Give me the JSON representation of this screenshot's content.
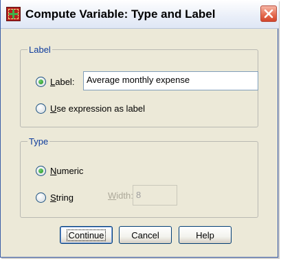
{
  "window": {
    "title": "Compute Variable: Type and Label"
  },
  "label_group": {
    "legend": "Label",
    "label_option": {
      "mnemonic": "L",
      "rest": "abel:",
      "checked": true
    },
    "label_value": "Average monthly expense",
    "expression_option": {
      "mnemonic": "U",
      "rest": "se expression as label",
      "checked": false
    }
  },
  "type_group": {
    "legend": "Type",
    "numeric_option": {
      "mnemonic": "N",
      "rest": "umeric",
      "checked": true
    },
    "string_option": {
      "mnemonic": "S",
      "rest": "tring",
      "checked": false
    },
    "width_label_mnemonic": "W",
    "width_label_rest": "idth:",
    "width_value": "8"
  },
  "buttons": {
    "continue": "Continue",
    "cancel": "Cancel",
    "help": "Help"
  },
  "colors": {
    "dialog_bg": "#ece9d8",
    "group_legend": "#0d3b9c",
    "radio_checked": "#218c21",
    "close_button": "#e4694d"
  },
  "icons": {
    "app": "compute-variable-icon",
    "close": "close-icon"
  }
}
